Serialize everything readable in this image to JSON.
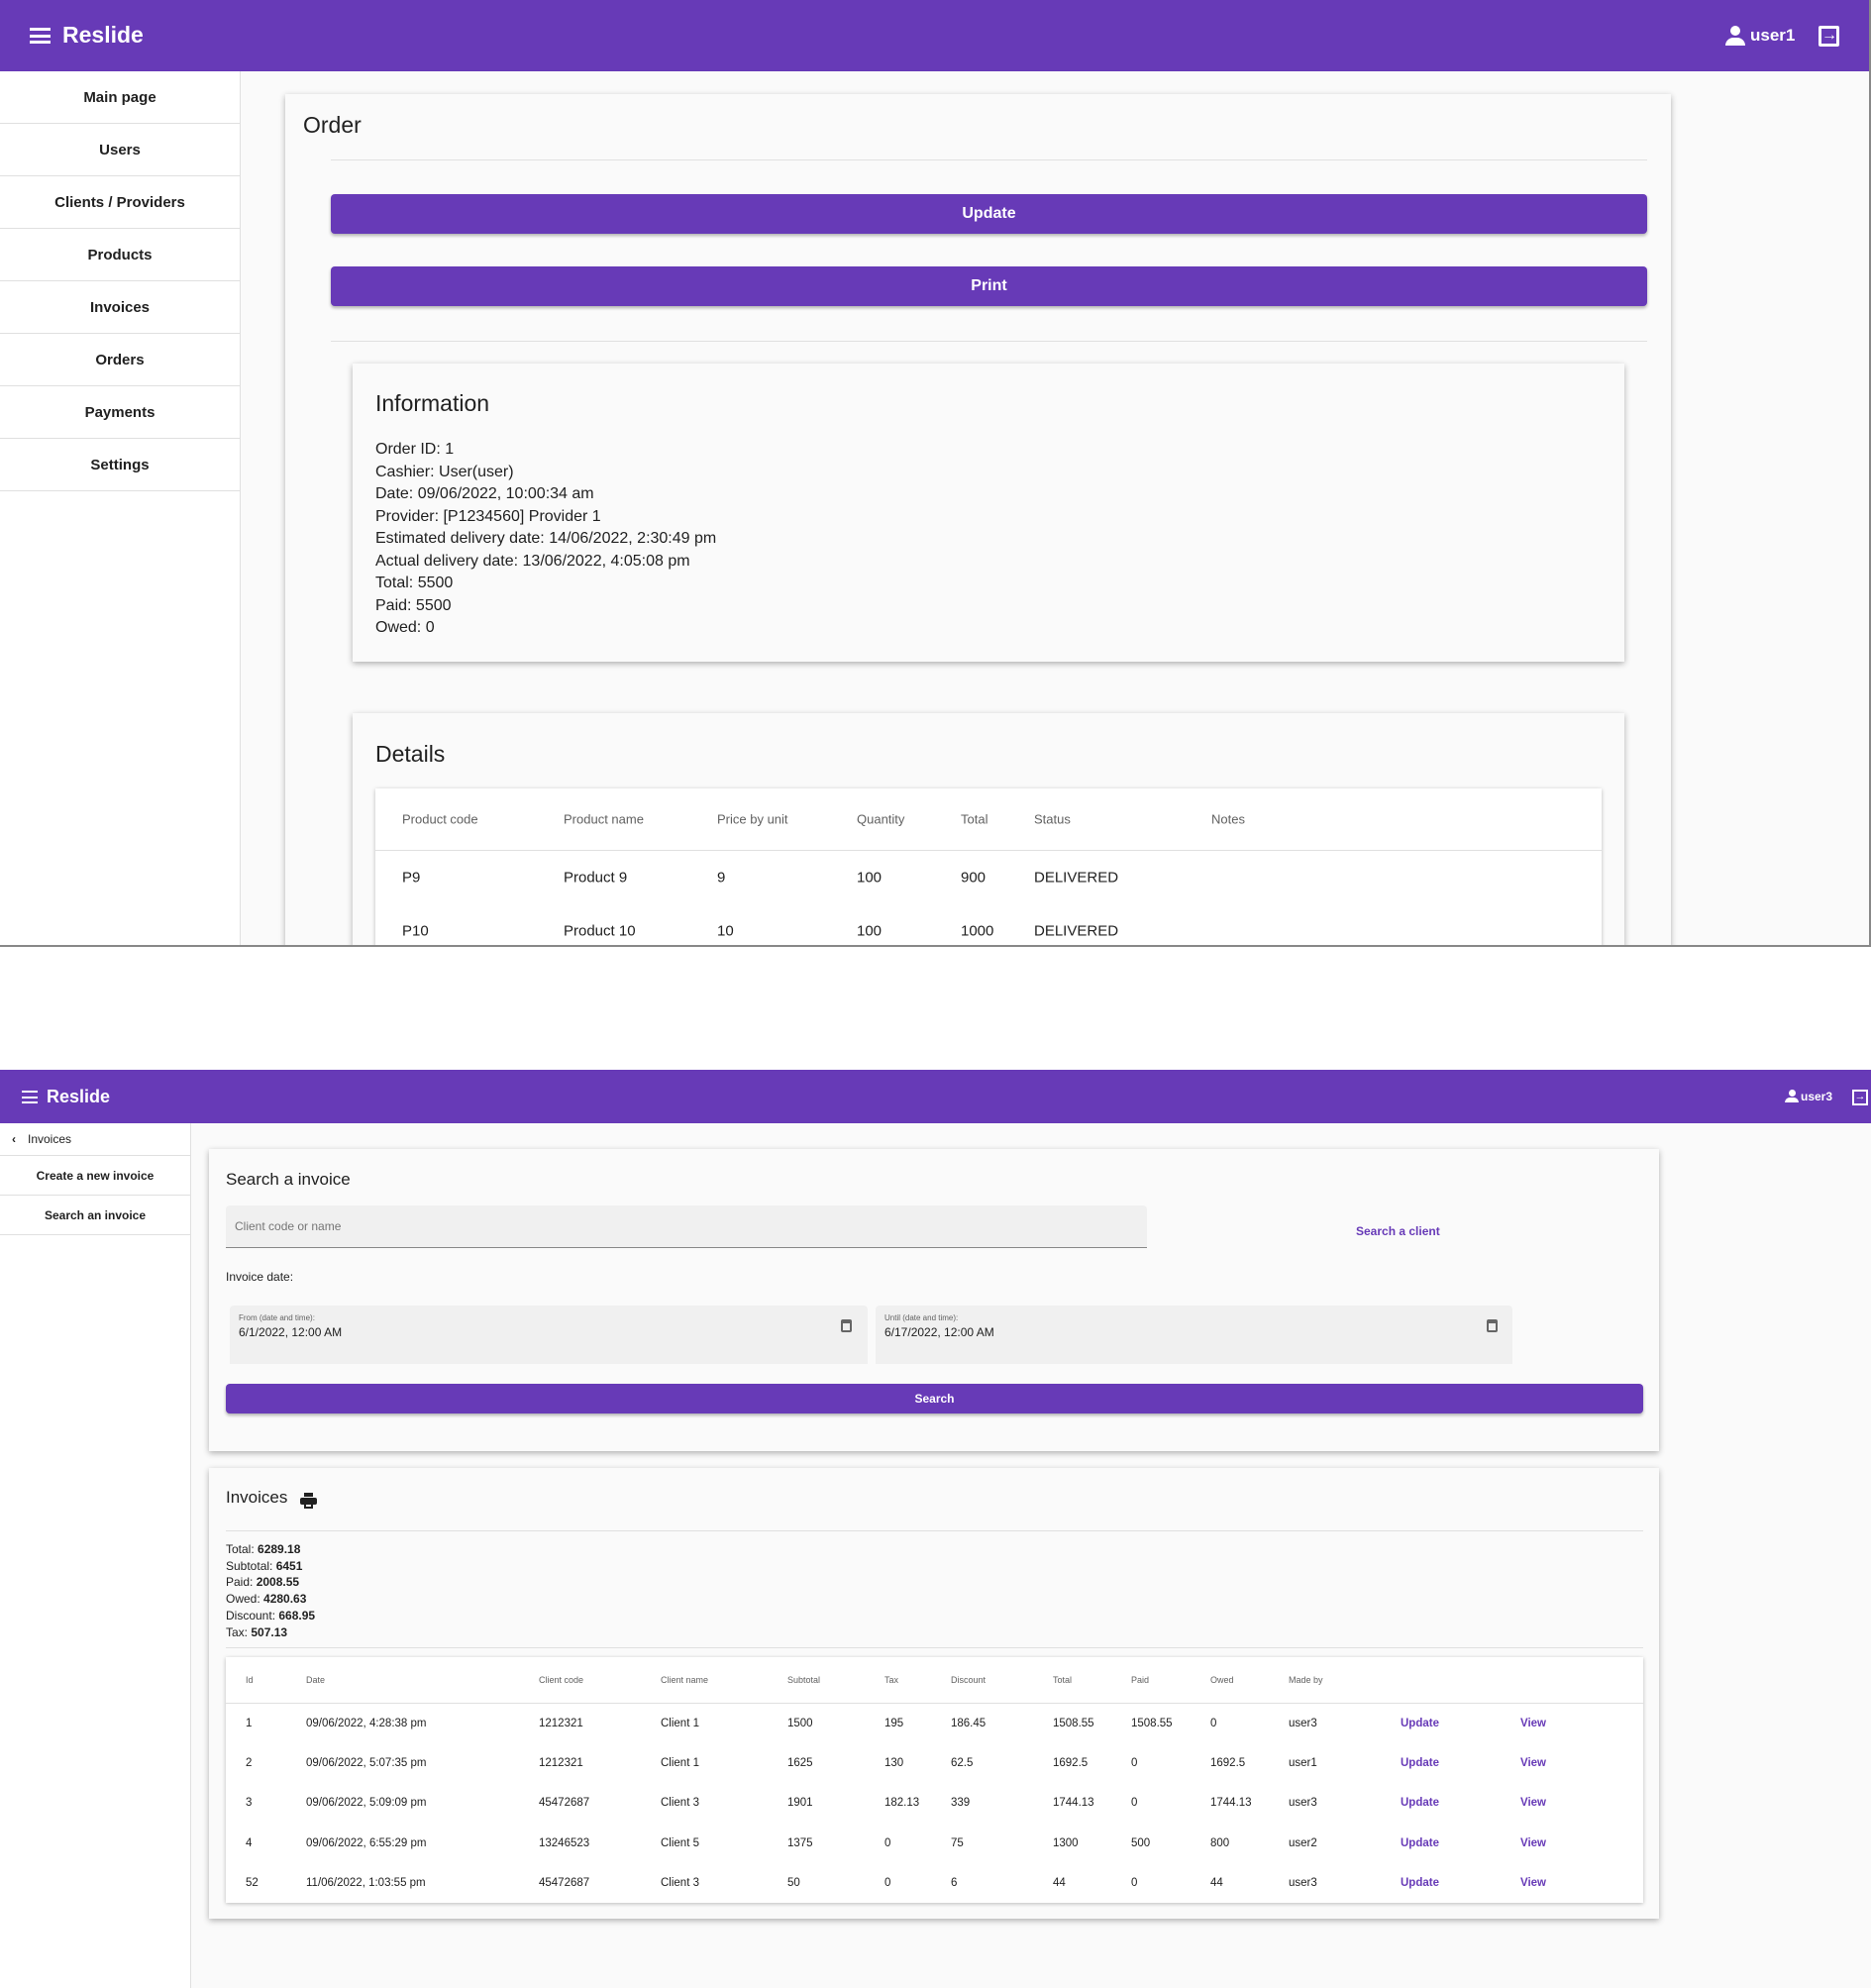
{
  "top": {
    "app_title": "Reslide",
    "username": "user1",
    "sidebar": [
      "Main page",
      "Users",
      "Clients / Providers",
      "Products",
      "Invoices",
      "Orders",
      "Payments",
      "Settings"
    ],
    "page_title": "Order",
    "update_label": "Update",
    "print_label": "Print",
    "info": {
      "title": "Information",
      "lines": [
        "Order ID: 1",
        "Cashier: User(user)",
        "Date: 09/06/2022, 10:00:34 am",
        "Provider: [P1234560] Provider 1",
        "Estimated delivery date: 14/06/2022, 2:30:49 pm",
        "Actual delivery date: 13/06/2022, 4:05:08 pm",
        "Total: 5500",
        "Paid: 5500",
        "Owed: 0"
      ]
    },
    "details": {
      "title": "Details",
      "columns": [
        "Product code",
        "Product name",
        "Price by unit",
        "Quantity",
        "Total",
        "Status",
        "Notes"
      ],
      "rows": [
        [
          "P9",
          "Product 9",
          "9",
          "100",
          "900",
          "DELIVERED",
          ""
        ],
        [
          "P10",
          "Product 10",
          "10",
          "100",
          "1000",
          "DELIVERED",
          ""
        ]
      ]
    }
  },
  "bottom": {
    "app_title": "Reslide",
    "username": "user3",
    "sidebar": {
      "back_label": "Invoices",
      "items": [
        "Create a new invoice",
        "Search an invoice"
      ]
    },
    "search": {
      "title": "Search a invoice",
      "client_placeholder": "Client code or name",
      "search_client_label": "Search a client",
      "date_label": "Invoice date:",
      "from_label": "From (date and time):",
      "from_value": "6/1/2022, 12:00 AM",
      "until_label": "Until (date and time):",
      "until_value": "6/17/2022, 12:00 AM",
      "search_label": "Search"
    },
    "invoices": {
      "title": "Invoices",
      "summary": [
        {
          "label": "Total: ",
          "value": "6289.18"
        },
        {
          "label": "Subtotal: ",
          "value": "6451"
        },
        {
          "label": "Paid: ",
          "value": "2008.55"
        },
        {
          "label": "Owed: ",
          "value": "4280.63"
        },
        {
          "label": "Discount: ",
          "value": "668.95"
        },
        {
          "label": "Tax: ",
          "value": "507.13"
        }
      ],
      "columns": [
        "Id",
        "Date",
        "Client code",
        "Client name",
        "Subtotal",
        "Tax",
        "Discount",
        "Total",
        "Paid",
        "Owed",
        "Made by",
        "",
        ""
      ],
      "rows": [
        [
          "1",
          "09/06/2022, 4:28:38 pm",
          "1212321",
          "Client 1",
          "1500",
          "195",
          "186.45",
          "1508.55",
          "1508.55",
          "0",
          "user3",
          "Update",
          "View"
        ],
        [
          "2",
          "09/06/2022, 5:07:35 pm",
          "1212321",
          "Client 1",
          "1625",
          "130",
          "62.5",
          "1692.5",
          "0",
          "1692.5",
          "user1",
          "Update",
          "View"
        ],
        [
          "3",
          "09/06/2022, 5:09:09 pm",
          "45472687",
          "Client 3",
          "1901",
          "182.13",
          "339",
          "1744.13",
          "0",
          "1744.13",
          "user3",
          "Update",
          "View"
        ],
        [
          "4",
          "09/06/2022, 6:55:29 pm",
          "13246523",
          "Client 5",
          "1375",
          "0",
          "75",
          "1300",
          "500",
          "800",
          "user2",
          "Update",
          "View"
        ],
        [
          "52",
          "11/06/2022, 1:03:55 pm",
          "45472687",
          "Client 3",
          "50",
          "0",
          "6",
          "44",
          "0",
          "44",
          "user3",
          "Update",
          "View"
        ]
      ]
    }
  },
  "colors": {
    "primary": "#673ab7"
  }
}
